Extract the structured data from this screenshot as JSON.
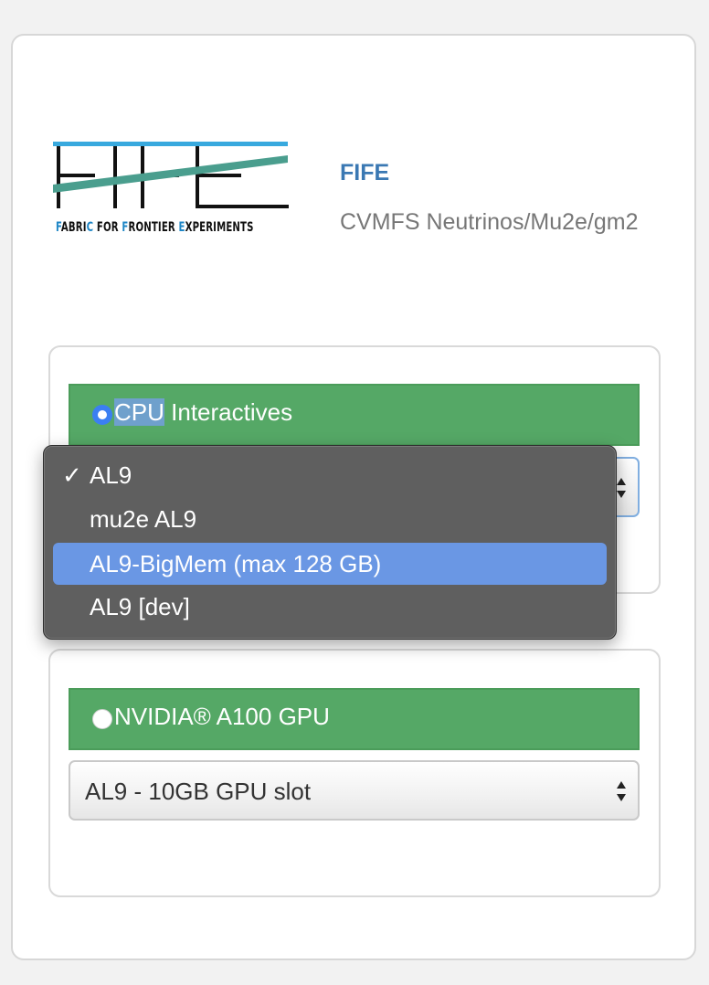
{
  "header": {
    "logo_text": "FIFE",
    "logo_caption": [
      "F",
      "ABRI",
      "C",
      " FOR ",
      "F",
      "RONTIER ",
      "E",
      "XPERIMENTS"
    ],
    "title": "FIFE",
    "subtitle": "CVMFS Neutrinos/Mu2e/gm2"
  },
  "cpu_option": {
    "label_selected_part": "CPU",
    "label_rest": " Interactives",
    "radio_checked": true,
    "dropdown_open": true,
    "options": [
      {
        "label": "AL9",
        "checked": true,
        "highlighted": false
      },
      {
        "label": "mu2e AL9",
        "checked": false,
        "highlighted": false
      },
      {
        "label": "AL9-BigMem (max 128 GB)",
        "checked": false,
        "highlighted": true
      },
      {
        "label": "AL9 [dev]",
        "checked": false,
        "highlighted": false
      }
    ],
    "check_glyph": "✓"
  },
  "gpu_option": {
    "label": "NVIDIA® A100 GPU",
    "radio_checked": false,
    "selected_value": "AL9 - 10GB GPU slot"
  },
  "colors": {
    "option_header_green": "#55a866",
    "title_blue": "#3a78b3",
    "radio_blue": "#3b7ff2",
    "menu_highlight": "#6a97e4",
    "menu_bg": "#5f5f5f",
    "logo_teal": "#4a9e8e",
    "logo_blue": "#38a9de"
  }
}
